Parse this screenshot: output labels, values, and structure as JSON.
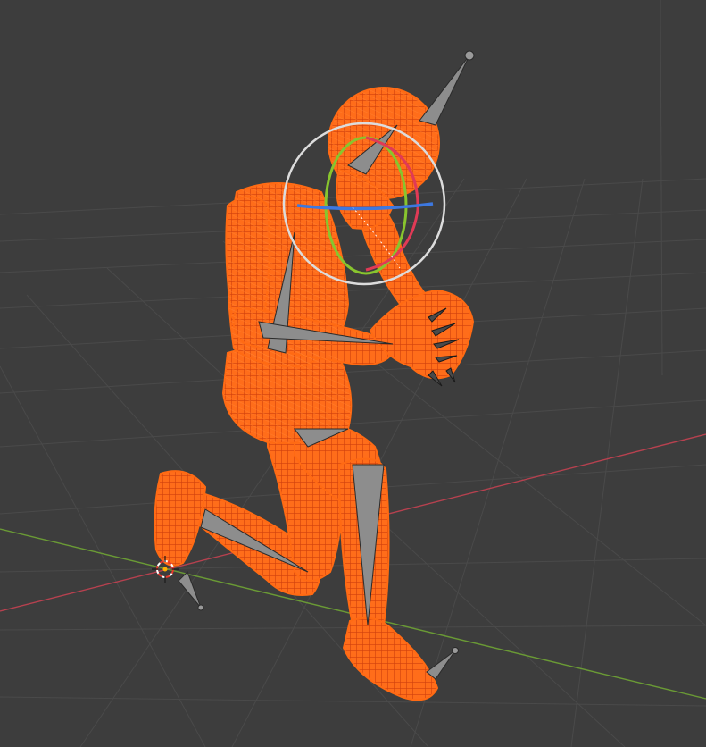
{
  "viewport": {
    "background": "#3d3d3d",
    "grid_color": "#4a4a4a",
    "axis_x_color": "#b7414f",
    "axis_y_color": "#6a9a35"
  },
  "selection": {
    "outline_color": "#ff6a13",
    "wire_color": "#e23a12",
    "bone_color": "#8d8d8d",
    "selected_object": "armature-mannequin",
    "pose": "kneeling"
  },
  "gizmo": {
    "mode": "rotate",
    "icon": "rotate-gizmo-icon",
    "ring_x_color": "#e03a56",
    "ring_y_color": "#88c52e",
    "ring_z_color": "#3d78e0",
    "ring_view_color": "#dcdcdc"
  },
  "cursor": {
    "icon": "3d-cursor-icon",
    "colors": [
      "#e8382d",
      "#ffffff"
    ]
  }
}
